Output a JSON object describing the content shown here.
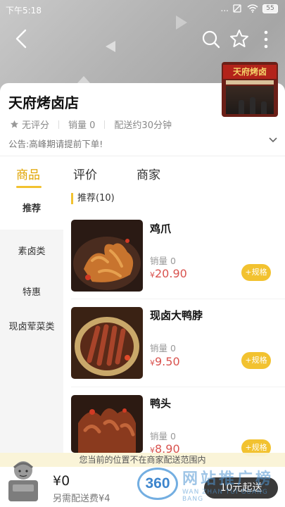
{
  "status_bar": {
    "time": "下午5:18",
    "signal_dots": "...",
    "battery": "55"
  },
  "store": {
    "name": "天府烤卤店",
    "rating": "无评分",
    "sales": "销量 0",
    "delivery_time": "配送约30分钟",
    "notice": "公告:高峰期请提前下单!",
    "photo_sign": "天府烤卤"
  },
  "tabs": [
    {
      "label": "商品",
      "active": true
    },
    {
      "label": "评价",
      "active": false
    },
    {
      "label": "商家",
      "active": false
    }
  ],
  "categories": [
    {
      "label": "推荐",
      "active": true
    },
    {
      "label": "素卤类",
      "active": false
    },
    {
      "label": "特惠",
      "active": false
    },
    {
      "label": "现卤荤菜类",
      "active": false
    }
  ],
  "section_title": "推荐(10)",
  "items": [
    {
      "name": "鸡爪",
      "sales": "销量 0",
      "currency": "¥",
      "price": "20.90",
      "spec_label": "+规格"
    },
    {
      "name": "现卤大鸭脖",
      "sales": "销量 0",
      "currency": "¥",
      "price": "9.50",
      "spec_label": "+规格"
    },
    {
      "name": "鸭头",
      "sales": "销量 0",
      "currency": "¥",
      "price": "8.90",
      "spec_label": "+规格"
    }
  ],
  "delivery_tip": "您当前的位置不在商家配送范围内",
  "cart": {
    "total": "¥0",
    "delivery_fee": "另需配送费¥4",
    "min_order": "10元起送"
  },
  "watermark": {
    "badge": "360",
    "text": "网站推广榜",
    "url": "WAN ZHAN TUI GUANG BANG"
  },
  "colors": {
    "accent": "#f2c230",
    "active_tab": "#e0a400",
    "price": "#d9534f",
    "checkout": "#3a3a3a"
  }
}
